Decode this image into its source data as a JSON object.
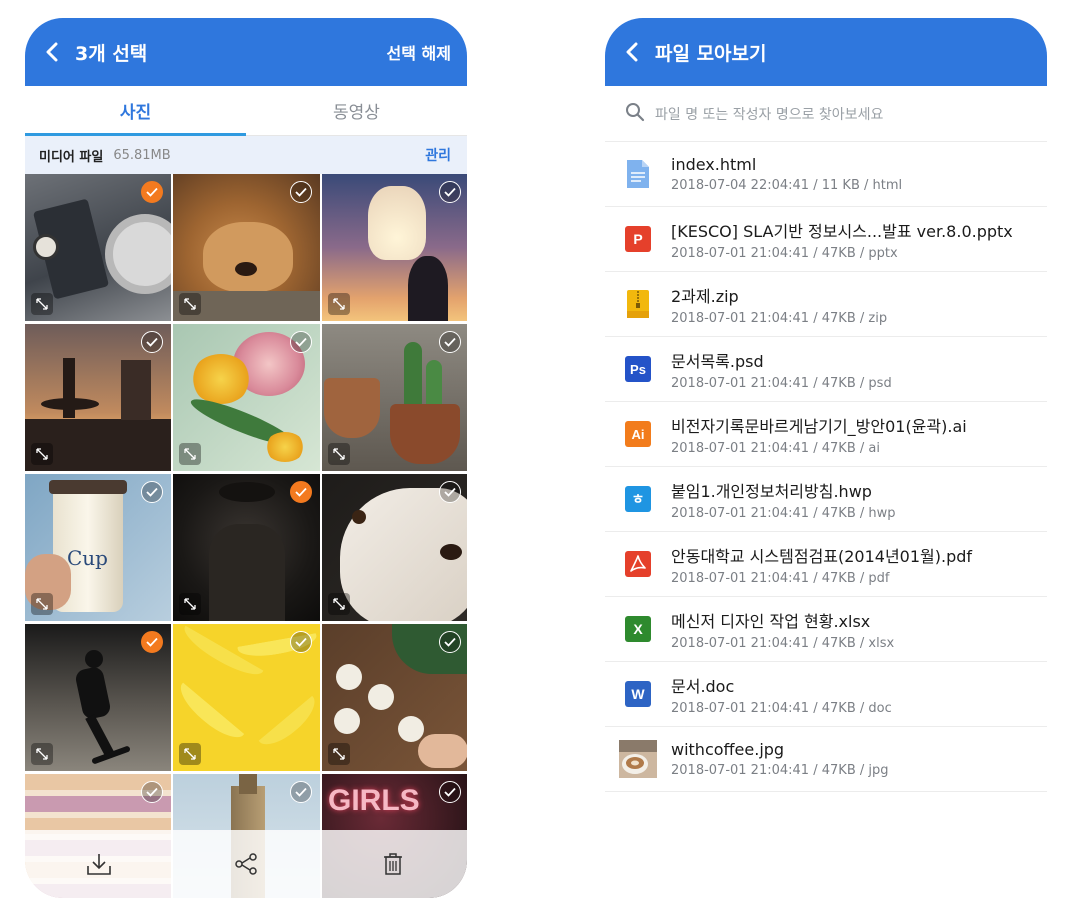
{
  "left_screen": {
    "header": {
      "title": "3개 선택",
      "action": "선택 해제"
    },
    "tabs": [
      {
        "label": "사진"
      },
      {
        "label": "동영상"
      }
    ],
    "info": {
      "label": "미디어 파일",
      "size": "65.81MB",
      "manage": "관리"
    },
    "photos": [
      {
        "subject": "watch and coffee on desk",
        "selected": true
      },
      {
        "subject": "dog resting",
        "selected": false
      },
      {
        "subject": "sky lantern at sunset",
        "selected": false
      },
      {
        "subject": "fountain silhouette at sunset",
        "selected": false
      },
      {
        "subject": "flowers bouquet",
        "selected": false
      },
      {
        "subject": "cactus pots",
        "selected": false
      },
      {
        "subject": "coffee cup in hand",
        "selected": false
      },
      {
        "subject": "man in dark with hat",
        "selected": true
      },
      {
        "subject": "white dog face",
        "selected": false
      },
      {
        "subject": "skateboarder silhouette",
        "selected": true
      },
      {
        "subject": "bananas on yellow",
        "selected": false
      },
      {
        "subject": "painting plants on table",
        "selected": false
      },
      {
        "subject": "macarons",
        "selected": false
      },
      {
        "subject": "big ben tower",
        "selected": false
      },
      {
        "subject": "neon girls sign",
        "selected": false
      }
    ],
    "cup_text": "Cup",
    "neon_text": "GIRLS",
    "bottom_actions": [
      {
        "icon": "download-icon"
      },
      {
        "icon": "share-icon"
      },
      {
        "icon": "trash-icon"
      }
    ]
  },
  "right_screen": {
    "header": {
      "title": "파일 모아보기"
    },
    "search": {
      "placeholder": "파일 명 또는 작성자 명으로 찾아보세요"
    },
    "files": [
      {
        "name": "index.html",
        "date": "2018-07-04 22:04:41",
        "size": "11 KB",
        "ext": "html",
        "icon": "html-doc-icon",
        "icon_text": "",
        "color": "#7fb2ee"
      },
      {
        "name": "[KESCO] SLA기반 정보시스...발표 ver.8.0.pptx",
        "date": "2018-07-01 21:04:41",
        "size": "47KB",
        "ext": "pptx",
        "icon": "powerpoint-icon",
        "icon_text": "P",
        "color": "#e5402b"
      },
      {
        "name": "2과제.zip",
        "date": "2018-07-01 21:04:41",
        "size": "47KB",
        "ext": "zip",
        "icon": "zip-icon",
        "icon_text": "",
        "color": "#f2b80d"
      },
      {
        "name": "문서목록.psd",
        "date": "2018-07-01 21:04:41",
        "size": "47KB",
        "ext": "psd",
        "icon": "photoshop-icon",
        "icon_text": "Ps",
        "color": "#2453c8"
      },
      {
        "name": "비전자기록문바르게남기기_방안01(윤곽).ai",
        "date": "2018-07-01 21:04:41",
        "size": "47KB",
        "ext": "ai",
        "icon": "illustrator-icon",
        "icon_text": "Ai",
        "color": "#f27c1c"
      },
      {
        "name": "붙임1.개인정보처리방침.hwp",
        "date": "2018-07-01 21:04:41",
        "size": "47KB",
        "ext": "hwp",
        "icon": "hwp-icon",
        "icon_text": "ㅎ",
        "color": "#1f95e2"
      },
      {
        "name": "안동대학교 시스템점검표(2014년01월).pdf",
        "date": "2018-07-01 21:04:41",
        "size": "47KB",
        "ext": "pdf",
        "icon": "pdf-icon",
        "icon_text": "",
        "color": "#e5402b"
      },
      {
        "name": "메신저 디자인 작업 현황.xlsx",
        "date": "2018-07-01 21:04:41",
        "size": "47KB",
        "ext": "xlsx",
        "icon": "excel-icon",
        "icon_text": "X",
        "color": "#2e8a2e"
      },
      {
        "name": "문서.doc",
        "date": "2018-07-01 21:04:41",
        "size": "47KB",
        "ext": "doc",
        "icon": "word-icon",
        "icon_text": "W",
        "color": "#2d64c4"
      },
      {
        "name": "withcoffee.jpg",
        "date": "2018-07-01 21:04:41",
        "size": "47KB",
        "ext": "jpg",
        "icon": "image-thumbnail",
        "icon_text": "",
        "color": "#c9a27a"
      }
    ],
    "separator": "/"
  },
  "colors": {
    "primary": "#2f77dd",
    "selected": "#f37a1f",
    "tab_indicator": "#2f9ae0"
  }
}
